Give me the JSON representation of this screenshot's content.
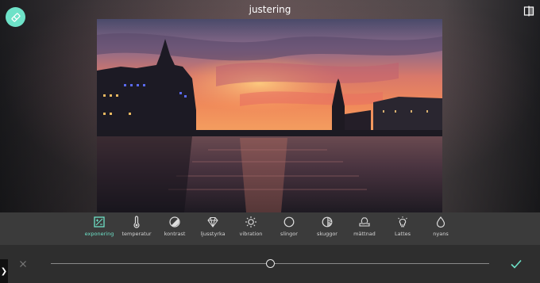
{
  "header": {
    "title": "justering",
    "undo_icon": "eraser-icon",
    "compare_icon": "compare-split-icon"
  },
  "photo": {
    "subject": "sunset-city-waterfront"
  },
  "tools": [
    {
      "label": "exponering",
      "icon": "exposure-icon",
      "active": true
    },
    {
      "label": "temperatur",
      "icon": "thermometer-icon",
      "active": false
    },
    {
      "label": "kontrast",
      "icon": "contrast-icon",
      "active": false
    },
    {
      "label": "ljusstyrka",
      "icon": "diamond-icon",
      "active": false
    },
    {
      "label": "vibration",
      "icon": "sun-icon",
      "active": false
    },
    {
      "label": "slingor",
      "icon": "circle-icon",
      "active": false
    },
    {
      "label": "skuggor",
      "icon": "shadows-icon",
      "active": false
    },
    {
      "label": "mättnad",
      "icon": "saturation-icon",
      "active": false
    },
    {
      "label": "Lattes",
      "icon": "lightbulb-icon",
      "active": false
    },
    {
      "label": "nyans",
      "icon": "drop-icon",
      "active": false
    }
  ],
  "slider": {
    "value_fraction": 0.5
  },
  "actions": {
    "cancel_icon": "close-icon",
    "apply_icon": "checkmark-icon",
    "drawer_glyph": "❯"
  },
  "colors": {
    "accent": "#6ee2c8",
    "toolbar_bg": "#3b3b3b",
    "bottom_bg": "#2e2e2e"
  }
}
